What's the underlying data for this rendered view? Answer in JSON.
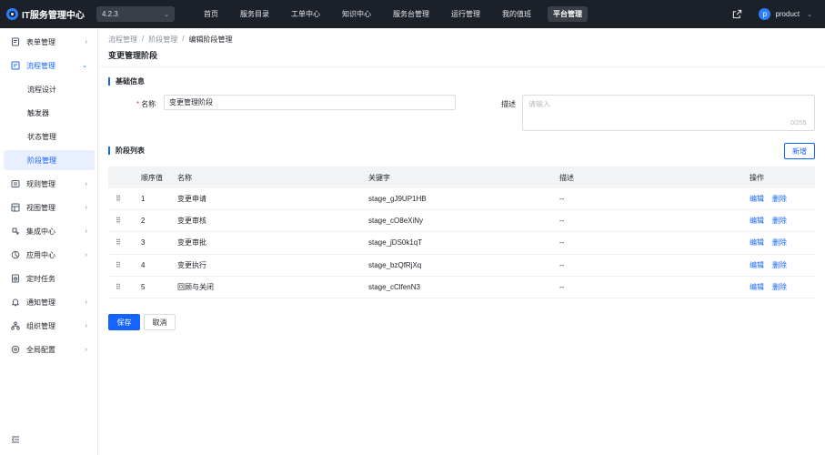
{
  "app": {
    "title": "IT服务管理中心",
    "version": "4.2.3",
    "accent": "#1664ff"
  },
  "nav": {
    "items": [
      "首页",
      "服务目录",
      "工单中心",
      "知识中心",
      "服务台管理",
      "运行管理",
      "我的值班",
      "平台管理"
    ],
    "active": "平台管理"
  },
  "user": {
    "initial": "p",
    "name": "product"
  },
  "sidebar": {
    "items": [
      {
        "label": "表单管理",
        "icon": "form-icon"
      },
      {
        "label": "流程管理",
        "icon": "flow-icon",
        "open": true
      },
      {
        "label": "规则管理",
        "icon": "rule-icon"
      },
      {
        "label": "视图管理",
        "icon": "view-icon"
      },
      {
        "label": "集成中心",
        "icon": "integration-icon"
      },
      {
        "label": "应用中心",
        "icon": "app-icon"
      },
      {
        "label": "定时任务",
        "icon": "timer-icon"
      },
      {
        "label": "通知管理",
        "icon": "bell-icon"
      },
      {
        "label": "组织管理",
        "icon": "org-icon"
      },
      {
        "label": "全局配置",
        "icon": "settings-icon"
      }
    ],
    "sub_items": [
      "流程设计",
      "触发器",
      "状态管理",
      "阶段管理"
    ],
    "active_sub": "阶段管理"
  },
  "breadcrumb": [
    "流程管理",
    "阶段管理",
    "编辑阶段管理"
  ],
  "page_title": "变更管理阶段",
  "basic_info": {
    "section_title": "基础信息",
    "name_label": "名称",
    "name_value": "变更管理阶段",
    "desc_label": "描述",
    "desc_placeholder": "请输入",
    "char_count": "0/255"
  },
  "stage_list": {
    "section_title": "阶段列表",
    "new_button": "新增",
    "columns": [
      "顺序值",
      "名称",
      "关键字",
      "描述",
      "操作"
    ],
    "rows": [
      {
        "order": "1",
        "name": "变更申请",
        "key": "stage_gJ9UP1HB",
        "desc": "--"
      },
      {
        "order": "2",
        "name": "变更审核",
        "key": "stage_cO8eXiNy",
        "desc": "--"
      },
      {
        "order": "3",
        "name": "变更审批",
        "key": "stage_jDS0k1qT",
        "desc": "--"
      },
      {
        "order": "4",
        "name": "变更执行",
        "key": "stage_bzQfRjXq",
        "desc": "--"
      },
      {
        "order": "5",
        "name": "回顾与关闭",
        "key": "stage_cClfenN3",
        "desc": "--"
      }
    ],
    "edit_label": "编辑",
    "delete_label": "删除"
  },
  "actions": {
    "save": "保存",
    "cancel": "取消"
  }
}
